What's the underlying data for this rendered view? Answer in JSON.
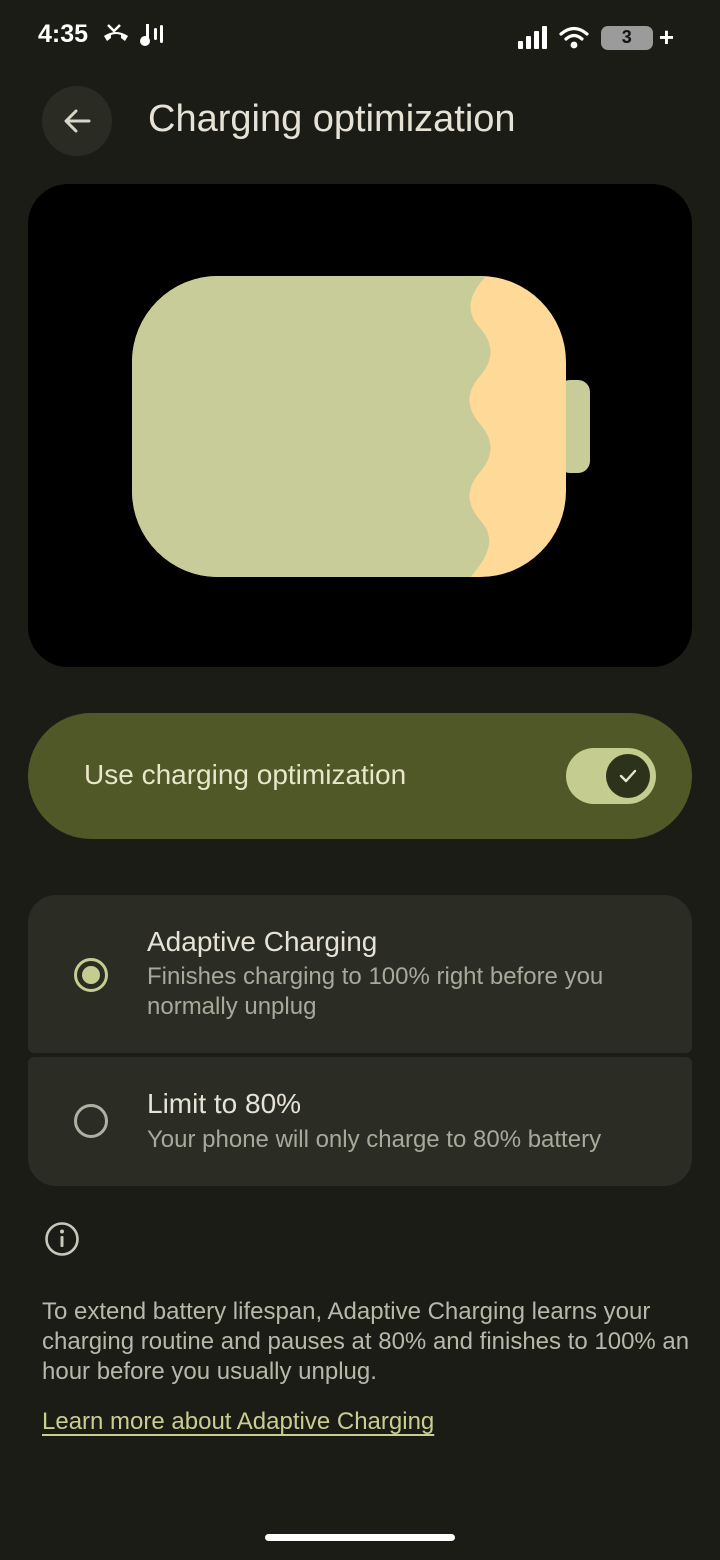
{
  "status_bar": {
    "time": "4:35",
    "battery_level": "3",
    "icons": [
      "missed-call-icon",
      "audio-icon",
      "signal-icon",
      "wifi-icon",
      "battery-icon",
      "charging-plus-icon"
    ]
  },
  "header": {
    "back_icon": "arrow-left-icon",
    "title": "Charging optimization"
  },
  "illustration": {
    "description_icon": "battery-illustration",
    "colors": {
      "background": "#000000",
      "body": "#c8cc98",
      "edge": "#ffd998"
    }
  },
  "main_toggle": {
    "label": "Use charging optimization",
    "checked": true,
    "icon": "check-icon"
  },
  "options": [
    {
      "title": "Adaptive Charging",
      "description": "Finishes charging to 100% right before you normally unplug",
      "selected": true
    },
    {
      "title": "Limit to 80%",
      "description": "Your phone will only charge to 80% battery",
      "selected": false
    }
  ],
  "footer": {
    "info_icon": "info-icon",
    "text": "To extend battery lifespan, Adaptive Charging learns your charging routine and pauses at 80% and finishes to 100% an hour before you usually unplug.",
    "link_label": "Learn more about Adaptive Charging"
  },
  "colors": {
    "background": "#1c1c16",
    "toggle_card": "#4f5826",
    "option_card": "#2b2d24",
    "accent": "#c5cc8f"
  }
}
